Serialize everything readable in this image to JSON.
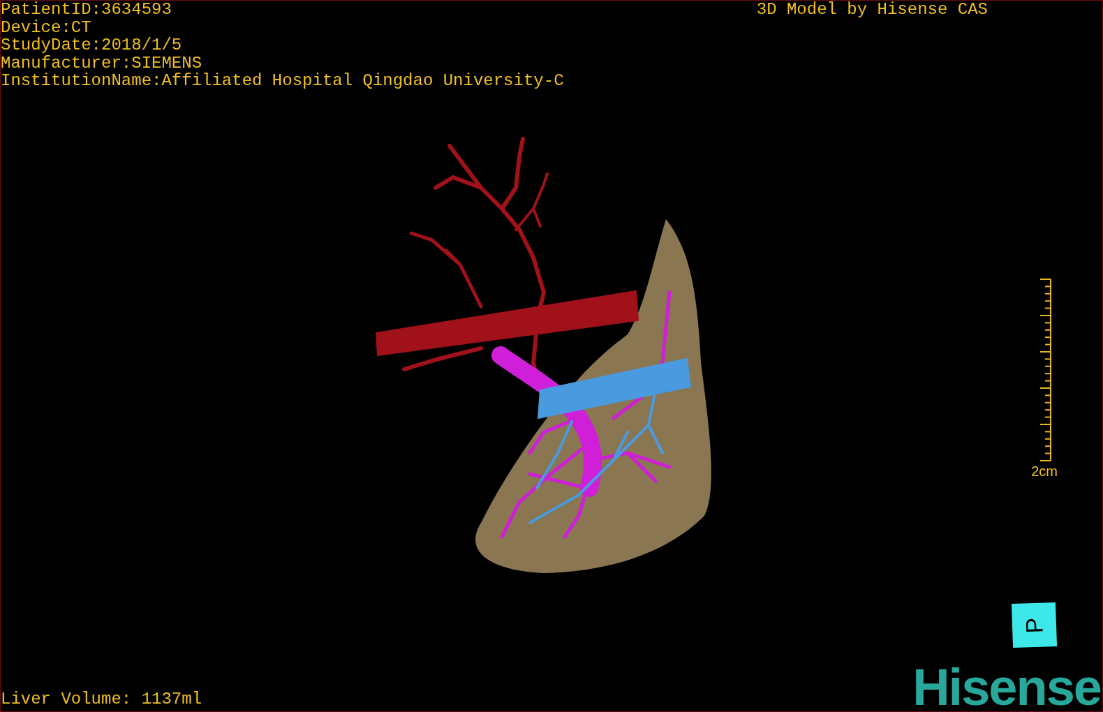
{
  "info_lines": [
    "PatientID:3634593",
    "Device:CT",
    "StudyDate:2018/1/5",
    "Manufacturer:SIEMENS",
    "InstitutionName:Affiliated Hospital Qingdao University-C"
  ],
  "credit": "3D Model by Hisense CAS",
  "scale_bar": {
    "label": "2cm"
  },
  "orientation_cube": {
    "label": "P"
  },
  "logo": "Hisense",
  "liver_volume": "Liver Volume: 1137ml"
}
